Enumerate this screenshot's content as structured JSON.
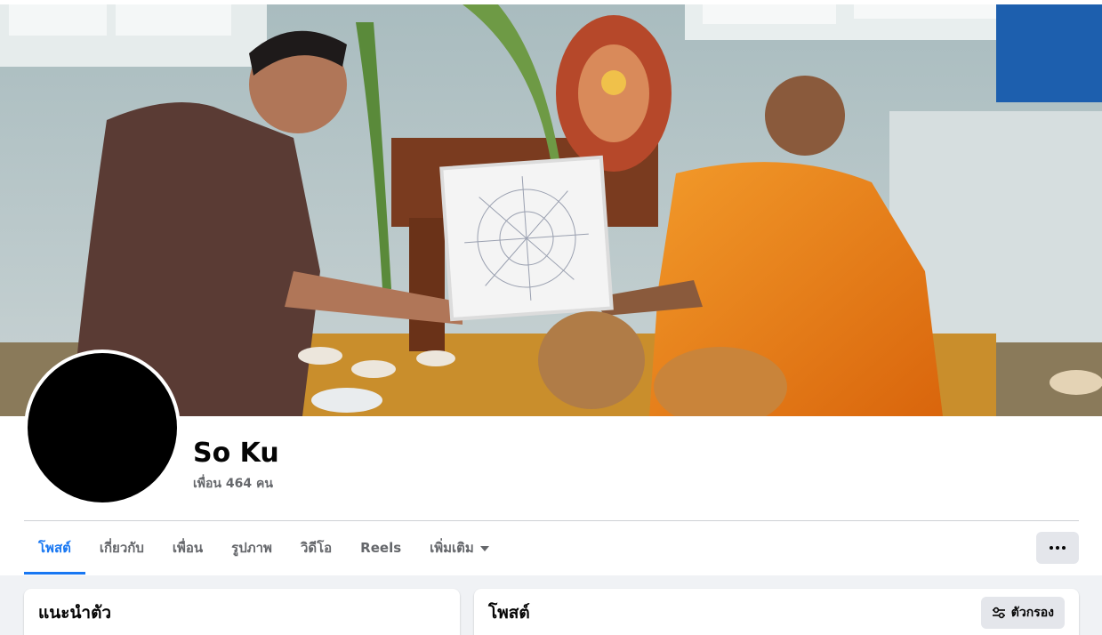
{
  "profile": {
    "name": "So Ku",
    "friends_text": "เพื่อน 464 คน"
  },
  "tabs": [
    {
      "label": "โพสต์",
      "active": true
    },
    {
      "label": "เกี่ยวกับ",
      "active": false
    },
    {
      "label": "เพื่อน",
      "active": false
    },
    {
      "label": "รูปภาพ",
      "active": false
    },
    {
      "label": "วิดีโอ",
      "active": false
    },
    {
      "label": "Reels",
      "active": false
    },
    {
      "label": "เพิ่มเติม",
      "active": false
    }
  ],
  "intro_card": {
    "title": "แนะนำตัว"
  },
  "posts_card": {
    "title": "โพสต์",
    "filter_label": "ตัวกรอง"
  },
  "colors": {
    "accent": "#1877f2",
    "page_background": "#f0f2f5",
    "secondary_text": "#65676b",
    "button_background": "#e4e6eb"
  },
  "icons": {
    "more": "ellipsis-icon",
    "more_tab": "caret-down-icon",
    "filter": "sliders-icon"
  }
}
